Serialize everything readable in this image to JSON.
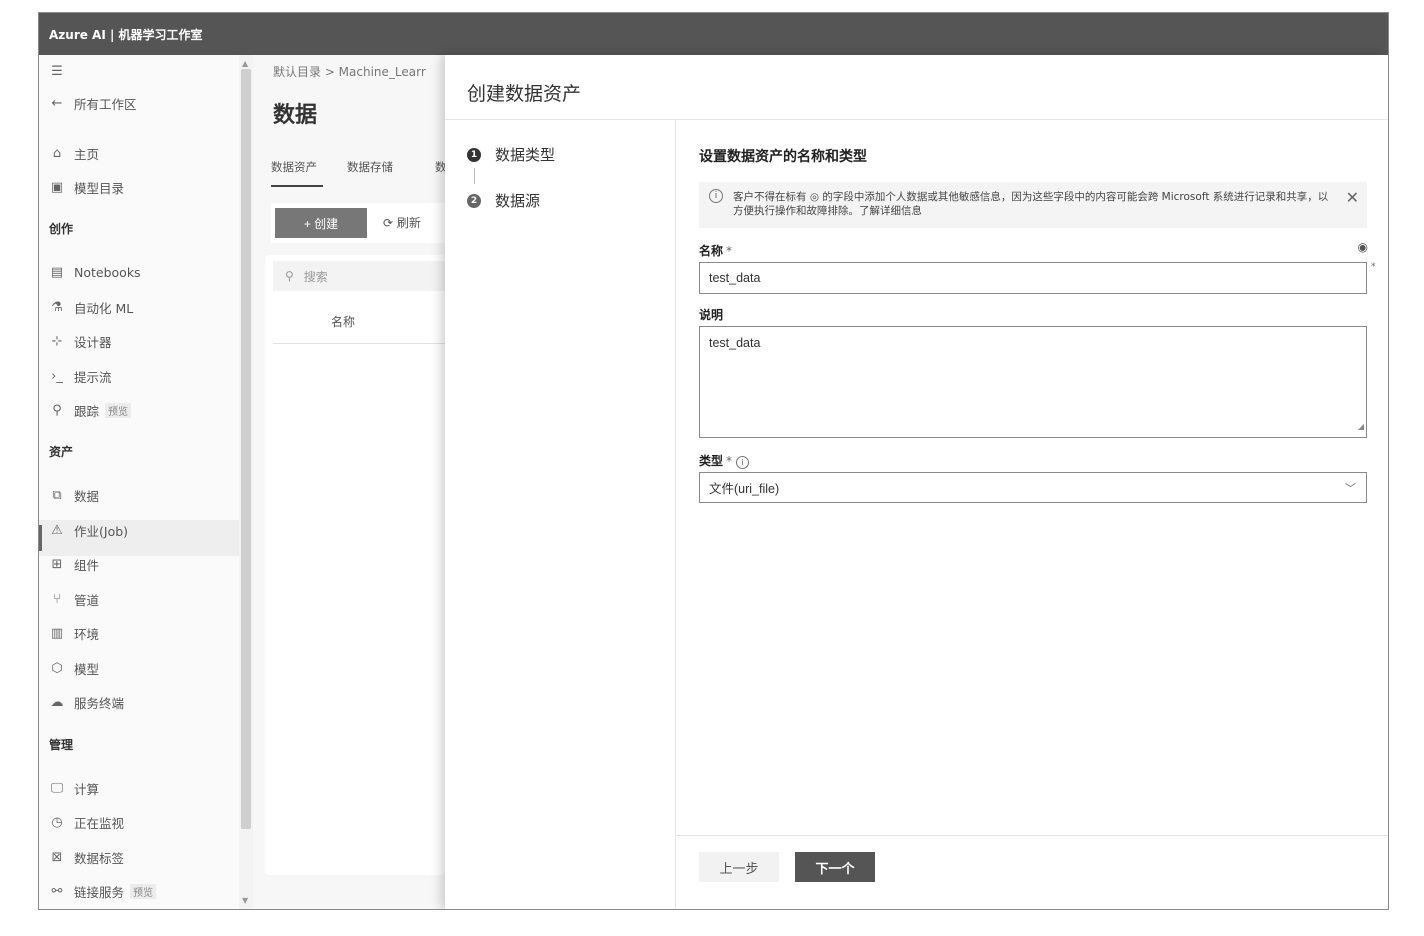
{
  "app": {
    "title": "Azure AI | 机器学习工作室"
  },
  "sidebar": {
    "all_workspaces": "所有工作区",
    "items_top": [
      {
        "label": "主页",
        "icon": "home-icon"
      },
      {
        "label": "模型目录",
        "icon": "model-catalog-icon"
      }
    ],
    "section_author": "创作",
    "items_author": [
      {
        "label": "Notebooks",
        "icon": "notebook-icon"
      },
      {
        "label": "自动化 ML",
        "icon": "automl-icon"
      },
      {
        "label": "设计器",
        "icon": "designer-icon"
      },
      {
        "label": "提示流",
        "icon": "prompt-flow-icon"
      },
      {
        "label": "跟踪",
        "icon": "tracking-icon",
        "badge": "预览"
      }
    ],
    "section_assets": "资产",
    "items_assets": [
      {
        "label": "数据",
        "icon": "data-icon"
      },
      {
        "label": "作业(Job)",
        "icon": "job-icon"
      },
      {
        "label": "组件",
        "icon": "component-icon"
      },
      {
        "label": "管道",
        "icon": "pipeline-icon"
      },
      {
        "label": "环境",
        "icon": "environment-icon"
      },
      {
        "label": "模型",
        "icon": "model-icon"
      },
      {
        "label": "服务终端",
        "icon": "endpoint-icon"
      }
    ],
    "section_manage": "管理",
    "items_manage": [
      {
        "label": "计算",
        "icon": "compute-icon"
      },
      {
        "label": "正在监视",
        "icon": "monitor-icon"
      },
      {
        "label": "数据标签",
        "icon": "labeling-icon"
      },
      {
        "label": "链接服务",
        "icon": "linked-service-icon",
        "badge": "预览"
      }
    ]
  },
  "mid": {
    "breadcrumb": "默认目录  >  Machine_Learr",
    "title": "数据",
    "tabs": [
      "数据资产",
      "数据存储",
      "数"
    ],
    "create_label": "+ 创建",
    "refresh_label": "刷新",
    "search_placeholder": "搜索",
    "col_name": "名称"
  },
  "panel": {
    "title": "创建数据资产",
    "steps": [
      {
        "num": "1",
        "label": "数据类型"
      },
      {
        "num": "2",
        "label": "数据源"
      }
    ],
    "form_title": "设置数据资产的名称和类型",
    "info_text": "客户不得在标有 ◎ 的字段中添加个人数据或其他敏感信息，因为这些字段中的内容可能会跨 Microsoft 系统进行记录和共享，以方便执行操作和故障排除。了解详细信息",
    "name_label": "名称",
    "name_value": "test_data",
    "desc_label": "说明",
    "desc_value": "test_data",
    "type_label": "类型",
    "type_value": "文件(uri_file)",
    "prev_label": "上一步",
    "next_label": "下一个"
  }
}
